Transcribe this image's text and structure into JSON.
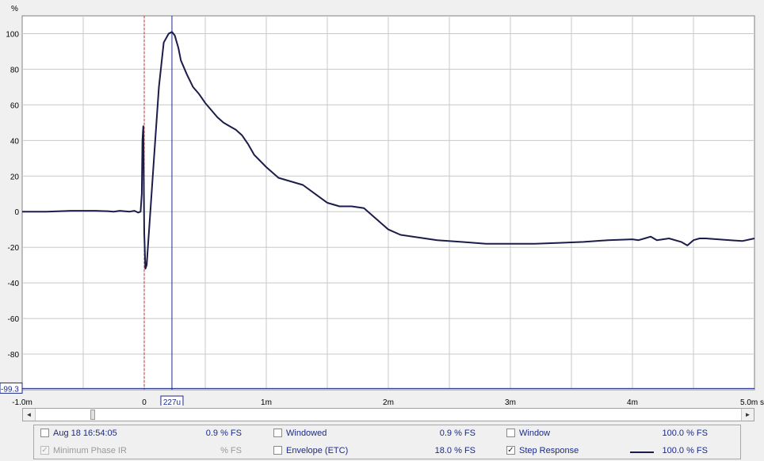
{
  "chart_data": {
    "type": "line",
    "ylabel": "%",
    "xlim": [
      -1.0,
      5.0
    ],
    "ylim": [
      -100,
      110
    ],
    "x_unit": "ms",
    "y_ticks": [
      100,
      80,
      60,
      40,
      20,
      0,
      -20,
      -40,
      -60,
      -80
    ],
    "y_tick_labels": [
      "100",
      "80",
      "60",
      "40",
      "20",
      "0",
      "-20",
      "-40",
      "-60",
      "-80"
    ],
    "x_ticks": [
      -1.0,
      0,
      1,
      2,
      3,
      4,
      5
    ],
    "x_tick_labels": [
      "-1.0m",
      "0",
      "1m",
      "2m",
      "3m",
      "4m",
      "5.0m s"
    ],
    "grid": true,
    "cursor_x_label": "227u",
    "cursor_x": 0.227,
    "reference_line_x": 0,
    "reference_line_y": -99.3,
    "reference_line_y_label": "-99.3",
    "series": [
      {
        "name": "Step Response",
        "color": "#1c1c4a",
        "x": [
          -1.0,
          -0.8,
          -0.6,
          -0.4,
          -0.3,
          -0.25,
          -0.2,
          -0.12,
          -0.08,
          -0.05,
          -0.03,
          -0.02,
          -0.015,
          -0.008,
          0.0,
          0.01,
          0.02,
          0.03,
          0.05,
          0.08,
          0.12,
          0.16,
          0.2,
          0.227,
          0.25,
          0.28,
          0.3,
          0.35,
          0.4,
          0.45,
          0.5,
          0.55,
          0.6,
          0.65,
          0.7,
          0.75,
          0.8,
          0.85,
          0.9,
          1.0,
          1.1,
          1.2,
          1.3,
          1.4,
          1.5,
          1.6,
          1.7,
          1.8,
          1.9,
          2.0,
          2.1,
          2.2,
          2.4,
          2.6,
          2.8,
          3.0,
          3.2,
          3.4,
          3.6,
          3.8,
          4.0,
          4.05,
          4.1,
          4.15,
          4.2,
          4.3,
          4.4,
          4.45,
          4.5,
          4.55,
          4.6,
          4.7,
          4.8,
          4.9,
          5.0
        ],
        "y": [
          0,
          0,
          0.5,
          0.5,
          0.3,
          0,
          0.5,
          0,
          0.5,
          -0.5,
          0,
          10,
          40,
          48,
          -12,
          -32,
          -30,
          -20,
          0,
          30,
          70,
          95,
          100,
          101,
          99,
          92,
          85,
          77,
          70,
          66,
          61,
          57,
          53,
          50,
          48,
          46,
          43,
          38,
          32,
          25,
          19,
          17,
          15,
          10,
          5,
          3,
          3,
          2,
          -4,
          -10,
          -13,
          -14,
          -16,
          -17,
          -18,
          -18,
          -18,
          -17.5,
          -17,
          -16,
          -15.5,
          -16,
          -15,
          -14,
          -16,
          -15,
          -17,
          -19,
          -16,
          -15,
          -15,
          -15.5,
          -16,
          -16.5,
          -15
        ]
      }
    ]
  },
  "scrollbar": {
    "left_arrow": "◄",
    "right_arrow": "►"
  },
  "legend": {
    "row0": [
      {
        "label": "Aug 18 16:54:05",
        "value": "0.9 % FS",
        "checked": false
      },
      {
        "label": "Windowed",
        "value": "0.9 % FS",
        "checked": false
      },
      {
        "label": "Window",
        "value": "100.0 % FS",
        "checked": false
      }
    ],
    "row1": [
      {
        "label": "Minimum Phase IR",
        "value": "% FS",
        "checked": true,
        "disabled": true
      },
      {
        "label": "Envelope (ETC)",
        "value": "18.0 % FS",
        "checked": false
      },
      {
        "label": "Step Response",
        "value": "100.0 % FS",
        "checked": true
      }
    ]
  },
  "colors": {
    "trace": "#1c1c4a",
    "cursor": "#1a2a8a",
    "marker": "#cc3333",
    "grid": "#c8c8c8"
  }
}
